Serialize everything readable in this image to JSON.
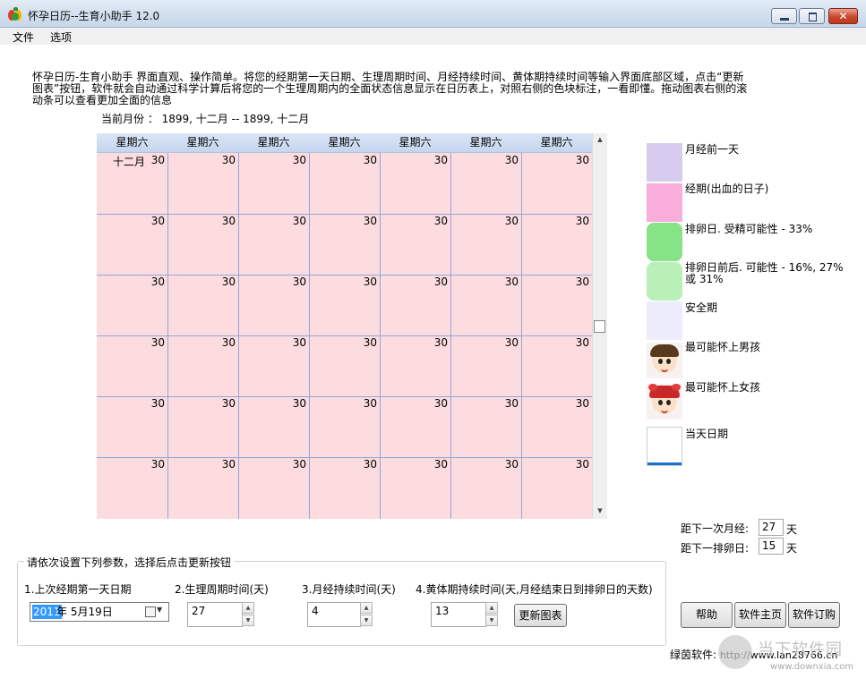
{
  "window": {
    "title": "怀孕日历--生育小助手 12.0",
    "controls": {
      "minimize": "",
      "maximize": "",
      "close": "✕"
    }
  },
  "menu": [
    "文件",
    "选项"
  ],
  "intro_text": "怀孕日历-生育小助手 界面直观、操作简单。将您的经期第一天日期、生理周期时间、月经持续时间、黄体期持续时间等输入界面底部区域，点击“更新图表”按钮，软件就会自动通过科学计算后将您的一个生理周期内的全面状态信息显示在日历表上，对照右侧的色块标注，一看即懂。拖动图表右侧的滚动条可以查看更加全面的信息",
  "current_month": "当前月份 ： 1899, 十二月 -- 1899, 十二月",
  "calendar": {
    "weekday_headers": [
      "星期六",
      "星期六",
      "星期六",
      "星期六",
      "星期六",
      "星期六",
      "星期六"
    ],
    "month_tag": "十二月",
    "rows": [
      [
        "30",
        "30",
        "30",
        "30",
        "30",
        "30",
        "30"
      ],
      [
        "30",
        "30",
        "30",
        "30",
        "30",
        "30",
        "30"
      ],
      [
        "30",
        "30",
        "30",
        "30",
        "30",
        "30",
        "30"
      ],
      [
        "30",
        "30",
        "30",
        "30",
        "30",
        "30",
        "30"
      ],
      [
        "30",
        "30",
        "30",
        "30",
        "30",
        "30",
        "30"
      ],
      [
        "30",
        "30",
        "30",
        "30",
        "30",
        "30",
        "30"
      ]
    ],
    "cell_color": "#fddcdf",
    "grid_color": "#8da7dc"
  },
  "legend": [
    {
      "label": "月经前一天",
      "color": "#d8cbf0"
    },
    {
      "label": "经期(出血的日子)",
      "color": "#f9addb"
    },
    {
      "label": "排卵日. 受精可能性 - 33%",
      "color": "#86e486"
    },
    {
      "label": "排卵日前后. 可能性 - 16%, 27% 或 31%",
      "color": "#b8f0b8"
    },
    {
      "label": "安全期",
      "color": "#ececfc"
    },
    {
      "label": "最可能怀上男孩",
      "icon": "boy-face-icon"
    },
    {
      "label": "最可能怀上女孩",
      "icon": "girl-face-icon"
    },
    {
      "label": "当天日期",
      "color": "#1874d3"
    }
  ],
  "countdown": {
    "next_period_label": "距下一次月经:",
    "next_period_value": "27",
    "next_ovulation_label": "距下一排卵日:",
    "next_ovulation_value": "15",
    "unit": "天"
  },
  "settings": {
    "group_title": "请依次设置下列参数，选择后点击更新按钮",
    "last_period_label": "1.上次经期第一天日期",
    "last_period_year": "2011",
    "last_period_rest": "年  5月19日",
    "cycle_label": "2.生理周期时间(天)",
    "cycle_value": "27",
    "duration_label": "3.月经持续时间(天)",
    "duration_value": "4",
    "luteal_label": "4.黄体期持续时间(天,月经结束日到排卵日的天数)",
    "luteal_value": "13",
    "update_button": "更新图表"
  },
  "buttons": {
    "help": "帮助",
    "homepage": "软件主页",
    "order": "软件订购"
  },
  "footer": {
    "label": "绿茵软件:",
    "url": "http://www.lan28766.cn"
  },
  "watermark": {
    "text": "当下软件园",
    "url": "www.downxia.com"
  }
}
